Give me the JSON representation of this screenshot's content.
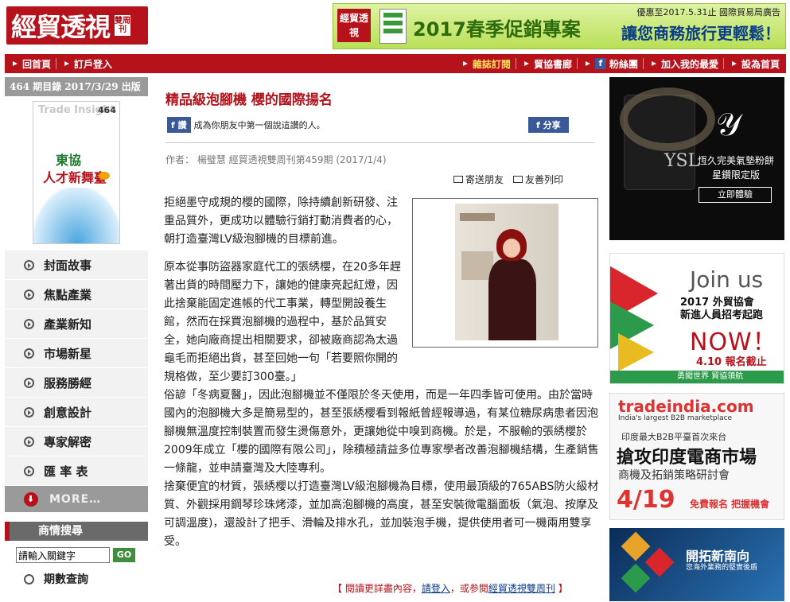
{
  "header": {
    "logo_main": "經貿透視",
    "logo_sub": "雙周刊",
    "banner": {
      "logo": "經貿透視",
      "title": "2017春季促銷專案",
      "slogan": "讓您商務旅行更輕鬆！",
      "note": "優惠至2017.5.31止  國際貿易局廣告"
    }
  },
  "nav": {
    "left": [
      "回首頁",
      "訂戶登入"
    ],
    "right": [
      "雜誌訂閱",
      "貿協書廊",
      "粉絲團",
      "加入我的最愛",
      "設為首頁"
    ]
  },
  "sidebar": {
    "issue": "464 期目錄  2017/3/29 出版",
    "cover": {
      "brand": "Trade Insight",
      "number": "464",
      "headline1": "東協",
      "headline2": "人才新舞臺"
    },
    "menu": [
      "封面故事",
      "焦點產業",
      "產業新知",
      "市場新星",
      "服務勝經",
      "創意設計",
      "專家解密",
      "匯 率 表"
    ],
    "more": "MORE…",
    "search_header": "商情搜尋",
    "search_value": "請輸入關鍵字",
    "search_go": "GO",
    "period_query": "期數查詢"
  },
  "article": {
    "title": "精品級泡腳機 櫻的國際揚名",
    "fb_like": "讚",
    "fb_text": "成為你朋友中第一個說這讚的人。",
    "share": "分享",
    "byline": "作者：  楊璧慧     經貿透視雙周刊第459期 (2017/1/4)",
    "send": "寄送朋友",
    "print": "友善列印",
    "p1": "拒絕墨守成規的櫻的國際，除持續創新研發、注重品質外，更成功以體驗行銷打動消費者的心，朝打造臺灣LV級泡腳機的目標前進。",
    "p2": "原本從事防盜器家庭代工的張綉櫻，在20多年趕著出貨的時間壓力下，讓她的健康亮起紅燈，因此捨棄能固定進帳的代工事業，轉型開設養生館，然而在採買泡腳機的過程中，基於品質安全，她向廠商提出相關要求，卻被廠商認為太過龜毛而拒絕出貨，甚至回她一句「若要照你開的規格做，至少要訂300臺。」",
    "p3": "俗諺「冬病夏醫」，因此泡腳機並不僅限於冬天使用，而是一年四季皆可使用。由於當時國內的泡腳機大多是簡易型的，甚至張綉櫻看到報紙曾經報導過，有某位糖尿病患者因泡腳機無溫度控制裝置而發生燙傷意外，更讓她從中嗅到商機。於是，不服輸的張綉櫻於2009年成立「櫻的國際有限公司」，除積極請益多位專家學者改善泡腳機結構，生產銷售一條龍，並申請臺灣及大陸專利。",
    "p4": "捨棄便宜的材質，張綉櫻以打造臺灣LV級泡腳機為目標，使用最頂級的765ABS防火級材質、外觀採用鋼琴珍珠烤漆，並加高泡腳機的高度，甚至安裝微電腦面板（氣泡、按摩及可調溫度)，還設計了把手、滑輪及排水孔，並加裝泡手機，提供使用者可一機兩用雙享受。",
    "foot_pre": "【 閱讀更詳盡內容，",
    "foot_login": "請登入",
    "foot_mid": "，或参閱",
    "foot_mag": "經貿透視雙周刊",
    "foot_end": " 】"
  },
  "ads": {
    "ad1": {
      "brand": "YSL",
      "line1": "恆久完美氣墊粉餅",
      "line2": "星鑽限定版",
      "button": "立即體驗"
    },
    "ad2": {
      "title": "Join us",
      "line1": "2017 外貿協會",
      "line2": "新進人員招考起跑",
      "now": "NOW！",
      "date": "4.10 報名截止",
      "bottom": "勇闖世界   貿協領航"
    },
    "ad3": {
      "brand": "tradeindia.com",
      "tagline": "India's largest B2B marketplace",
      "line1": "印度最大B2B平臺首次來台",
      "line2": "搶攻印度電商市場",
      "line3": "商機及拓銷策略研討會",
      "date": "4/19",
      "cta": "免費報名 把握機會"
    },
    "ad4": {
      "title": "開拓新南向",
      "sub": "您海外業務的堅實後盾"
    }
  }
}
